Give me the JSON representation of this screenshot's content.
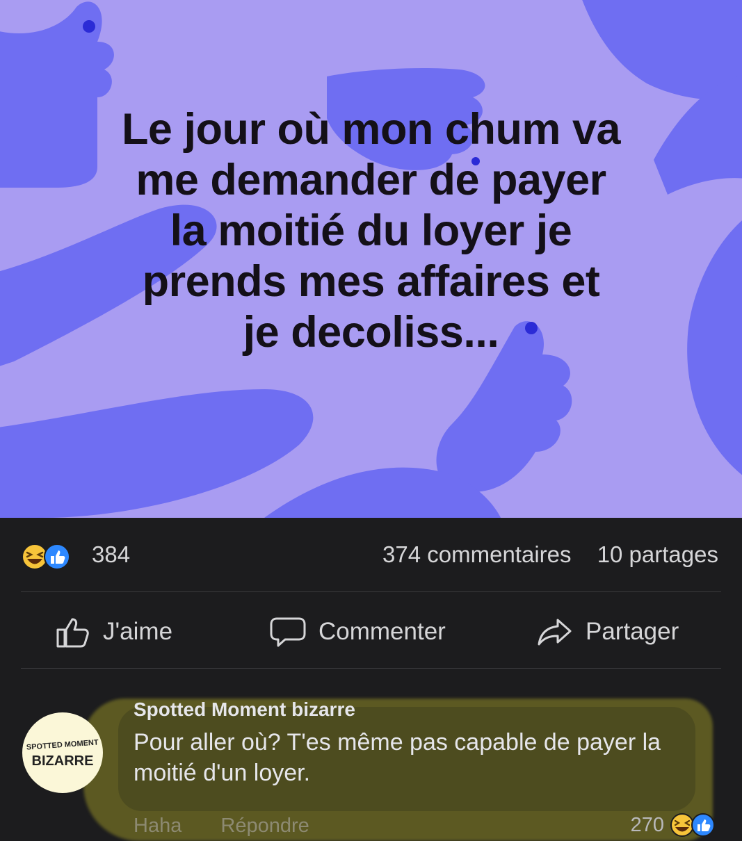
{
  "post": {
    "text_lines": [
      "Le jour où mon chum va",
      "me demander de payer",
      "la moitié du loyer je",
      "prends mes affaires et",
      "je decoliss..."
    ]
  },
  "stats": {
    "reaction_count": "384",
    "comments": "374 commentaires",
    "shares": "10 partages",
    "reaction_icons": [
      "haha-icon",
      "like-icon"
    ]
  },
  "actions": {
    "like_label": "J'aime",
    "comment_label": "Commenter",
    "share_label": "Partager"
  },
  "comment": {
    "avatar_text_top": "SPOTTED MOMENT",
    "avatar_text_bottom": "BIZARRE",
    "author": "Spotted Moment bizarre",
    "text": "Pour aller où? T'es même pas capable de payer la moitié d'un loyer.",
    "actions": [
      "Haha",
      "Répondre"
    ],
    "reaction_count": "270"
  },
  "colors": {
    "image_background": "#a99cf2",
    "image_shapes": "#6f6ef2",
    "footer_background": "#1c1c1e",
    "highlighter": "#928c26"
  }
}
